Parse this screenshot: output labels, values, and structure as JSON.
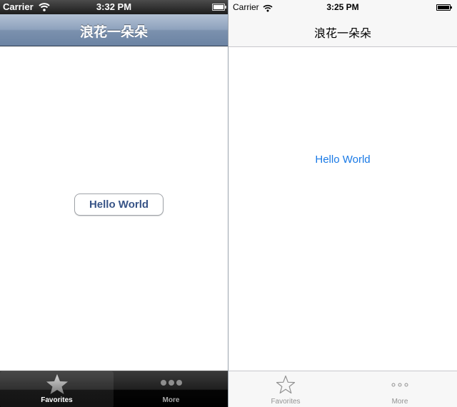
{
  "ios6": {
    "status": {
      "carrier": "Carrier",
      "time": "3:32 PM"
    },
    "nav": {
      "title": "浪花一朵朵"
    },
    "button_label": "Hello World",
    "tabs": [
      {
        "label": "Favorites",
        "icon": "star-icon",
        "selected": true
      },
      {
        "label": "More",
        "icon": "more-icon",
        "selected": false
      }
    ]
  },
  "ios7": {
    "status": {
      "carrier": "Carrier",
      "time": "3:25 PM"
    },
    "nav": {
      "title": "浪花一朵朵"
    },
    "button_label": "Hello World",
    "tabs": [
      {
        "label": "Favorites",
        "icon": "star-outline-icon",
        "selected": false
      },
      {
        "label": "More",
        "icon": "more-outline-icon",
        "selected": false
      }
    ]
  },
  "colors": {
    "ios6_nav": "#7b91ae",
    "ios6_button_text": "#385487",
    "ios7_tint": "#1a7ae6"
  }
}
